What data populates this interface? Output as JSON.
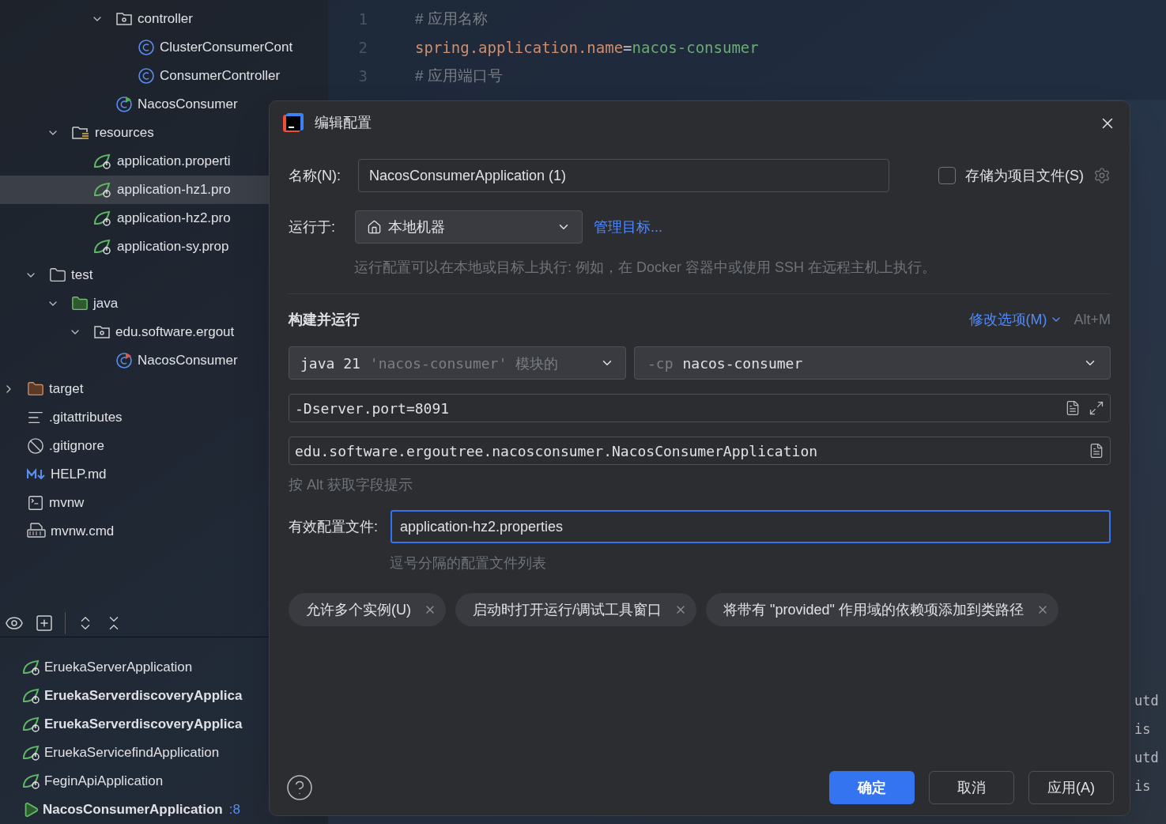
{
  "project_tree": [
    {
      "kind": "package",
      "label": "controller",
      "expanded": true,
      "selected": false,
      "children": [
        {
          "kind": "class",
          "label": "ClusterConsumerCont",
          "selected": false
        },
        {
          "kind": "class",
          "label": "ConsumerController",
          "selected": false
        }
      ]
    },
    {
      "kind": "app",
      "label": "NacosConsumer",
      "selected": false
    },
    {
      "kind": "resources",
      "label": "resources",
      "expanded": true,
      "selected": false,
      "children": [
        {
          "kind": "props",
          "label": "application.properti",
          "selected": false
        },
        {
          "kind": "props",
          "label": "application-hz1.pro",
          "selected": true
        },
        {
          "kind": "props",
          "label": "application-hz2.pro",
          "selected": false
        },
        {
          "kind": "props",
          "label": "application-sy.prop",
          "selected": false
        }
      ]
    },
    {
      "kind": "folder",
      "label": "test",
      "expanded": true,
      "selected": false,
      "children": [
        {
          "kind": "test-folder",
          "label": "java",
          "expanded": true,
          "selected": false,
          "children": [
            {
              "kind": "package",
              "label": "edu.software.ergout",
              "expanded": true,
              "selected": false,
              "children": [
                {
                  "kind": "test-class",
                  "label": "NacosConsumer",
                  "selected": false
                }
              ]
            }
          ]
        }
      ]
    },
    {
      "kind": "excluded",
      "label": "target",
      "expanded": false,
      "selected": false
    },
    {
      "kind": "text",
      "label": ".gitattributes",
      "selected": false
    },
    {
      "kind": "ignore",
      "label": ".gitignore",
      "selected": false
    },
    {
      "kind": "markdown",
      "label": "HELP.md",
      "selected": false
    },
    {
      "kind": "terminal",
      "label": "mvnw",
      "selected": false
    },
    {
      "kind": "cmd",
      "label": "mvnw.cmd",
      "selected": false
    }
  ],
  "run_configs": [
    {
      "kind": "spring",
      "label": "EruekaServerApplication",
      "active": false
    },
    {
      "kind": "spring",
      "label": "EruekaServerdiscoveryApplica",
      "active": true
    },
    {
      "kind": "spring",
      "label": "EruekaServerdiscoveryApplica",
      "active": true
    },
    {
      "kind": "spring",
      "label": "EruekaServicefindApplication",
      "active": false
    },
    {
      "kind": "spring",
      "label": "FeginApiApplication",
      "active": false
    },
    {
      "kind": "running",
      "label": "NacosConsumerApplication",
      "port": ":8",
      "active": true
    }
  ],
  "editor": {
    "lines": [
      {
        "number": "1",
        "kind": "comment",
        "text": "#  应用名称"
      },
      {
        "number": "2",
        "kind": "property",
        "key": "spring.application.name",
        "sep": "=",
        "value": "nacos-consumer"
      },
      {
        "number": "3",
        "kind": "comment",
        "text": "#  应用端口号"
      }
    ]
  },
  "console_fragments": [
    "utd",
    "is",
    "utd",
    "is"
  ],
  "dialog": {
    "title": "编辑配置",
    "name_label": "名称(N):",
    "name_value": "NacosConsumerApplication (1)",
    "store_as_file": {
      "label": "存储为项目文件(S)",
      "checked": false
    },
    "run_on_label": "运行于:",
    "run_on_value": "本地机器",
    "manage_targets": "管理目标...",
    "run_on_hint": "运行配置可以在本地或目标上执行: 例如，在 Docker 容器中或使用 SSH 在远程主机上执行。",
    "section_title": "构建并运行",
    "modify_options": "修改选项(M)",
    "modify_shortcut": "Alt+M",
    "jdk": {
      "value": "java 21",
      "hint": "'nacos-consumer' 模块的"
    },
    "classpath": {
      "flag": "-cp",
      "value": "nacos-consumer"
    },
    "vm_options": "-Dserver.port=8091",
    "main_class": "edu.software.ergoutree.nacosconsumer.NacosConsumerApplication",
    "alt_hint": "按 Alt 获取字段提示",
    "profiles_label": "有效配置文件:",
    "profiles_value": "application-hz2.properties",
    "profiles_hint": "逗号分隔的配置文件列表",
    "options": [
      "允许多个实例(U)",
      "启动时打开运行/调试工具窗口",
      "将带有 \"provided\" 作用域的依赖项添加到类路径"
    ],
    "buttons": [
      {
        "kind": "primary",
        "label": "确定"
      },
      {
        "kind": "secondary",
        "label": "取消"
      },
      {
        "kind": "secondary",
        "label": "应用(A)"
      }
    ]
  }
}
